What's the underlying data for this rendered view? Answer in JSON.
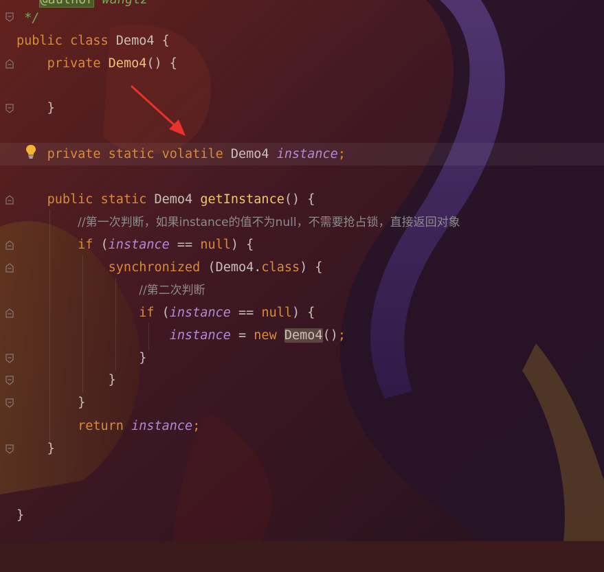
{
  "colors": {
    "keyword": "#d98a3a",
    "function": "#f0c470",
    "field": "#b38ad6",
    "comment": "#8c8c8c",
    "plain": "#c9c1b8",
    "annotation_arrow": "#e8322a"
  },
  "icons": {
    "fold_marker": "fold-icon",
    "intention_bulb": "lightbulb-icon",
    "annotation_arrow": "red-arrow-icon"
  },
  "code": {
    "top_partial": {
      "tag": "@author",
      "rest": " wanglz"
    },
    "doc_end": "*/",
    "class_decl": {
      "kw": "public class ",
      "name": "Demo4",
      "rest": " {"
    },
    "ctor": {
      "kw": "private ",
      "name": "Demo4",
      "rest": "() {"
    },
    "ctor_close": "}",
    "field_decl": {
      "kw": "private static volatile ",
      "type": "Demo4 ",
      "name": "instance",
      "semi": ";"
    },
    "method": {
      "kw": "public static ",
      "type": "Demo4 ",
      "name": "getInstance",
      "rest": "() {"
    },
    "comment1": "//第一次判断，如果instance的值不为null，不需要抢占锁，直接返回对象",
    "if1": {
      "kw": "if ",
      "open": "(",
      "field": "instance",
      "op": " == ",
      "null": "null",
      "close": ") {"
    },
    "sync": {
      "kw": "synchronized ",
      "open": "(Demo4.",
      "cls": "class",
      "close": ") {"
    },
    "comment2": "//第二次判断",
    "if2": {
      "kw": "if ",
      "open": "(",
      "field": "instance",
      "op": " == ",
      "null": "null",
      "close": ") {"
    },
    "assign": {
      "field": "instance",
      "eq": " = ",
      "kw": "new ",
      "ctor": "Demo4",
      "rest": "()",
      "semi": ";"
    },
    "close_brace": "}",
    "ret": {
      "kw": "return ",
      "field": "instance",
      "semi": ";"
    }
  }
}
